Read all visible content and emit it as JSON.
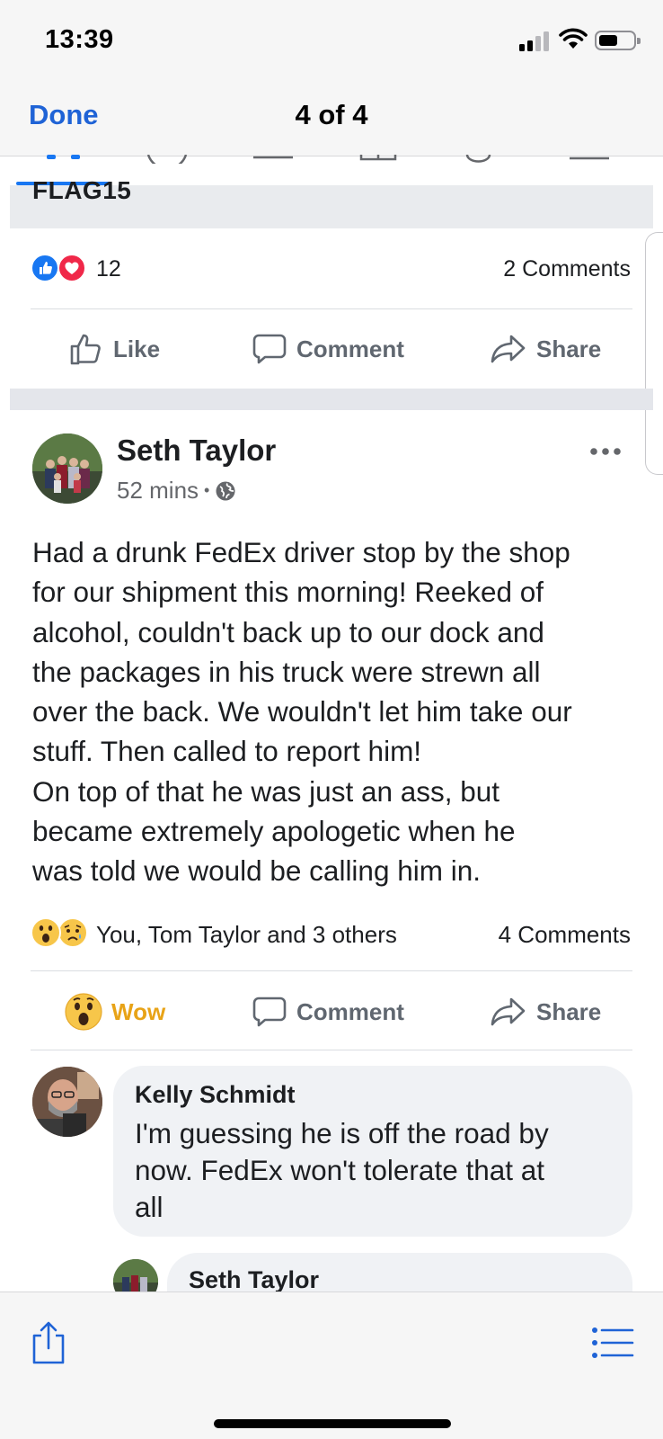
{
  "status_bar": {
    "time": "13:39"
  },
  "nav": {
    "done_label": "Done",
    "page_indicator": "4 of 4"
  },
  "previous_post": {
    "title_fragment": "FLAG15",
    "reaction_count": "12",
    "comments_label": "2 Comments",
    "actions": {
      "like": "Like",
      "comment": "Comment",
      "share": "Share"
    }
  },
  "post": {
    "author": "Seth Taylor",
    "time": "52 mins",
    "separator": "•",
    "body_lines": [
      "Had a drunk FedEx driver stop by the shop",
      "for our shipment this morning! Reeked of",
      "alcohol, couldn't back up to our dock and",
      "the packages in his truck were strewn all",
      "over the back. We wouldn't let him take our",
      "stuff. Then called to report him!",
      "On top of that he was just an ass, but",
      "became extremely apologetic when he",
      "was told we would be calling him in."
    ],
    "reaction_names": "You, Tom Taylor and 3 others",
    "comments_label": "4 Comments",
    "actions": {
      "wow": "Wow",
      "comment": "Comment",
      "share": "Share"
    }
  },
  "comments": [
    {
      "author": "Kelly Schmidt",
      "lines": [
        "I'm guessing he is off the road by",
        "now.  FedEx won't tolerate that at",
        "all"
      ]
    },
    {
      "author": "Seth Taylor"
    }
  ],
  "colors": {
    "accent_blue": "#1f63d6",
    "wow_yellow": "#e8a317",
    "like_blue": "#1877f2",
    "love_red": "#f02849"
  }
}
